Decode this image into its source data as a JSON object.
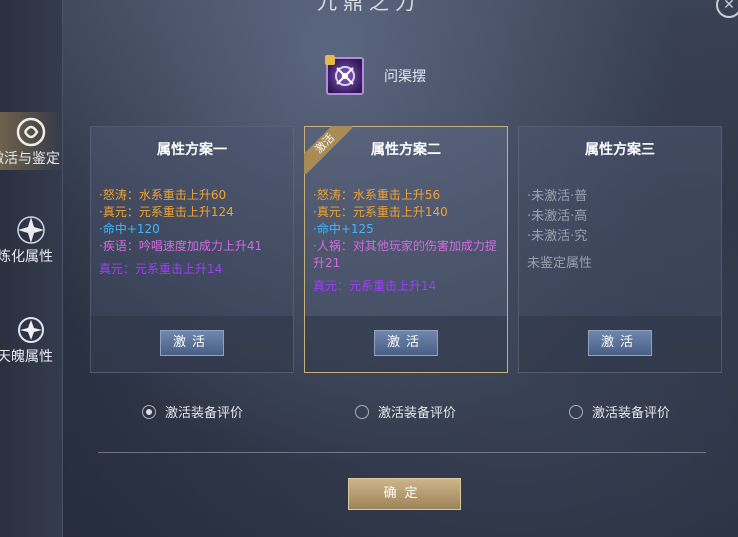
{
  "window": {
    "title": "九鼎之力",
    "close_label": "✕"
  },
  "item": {
    "name": "问渠摆"
  },
  "sidebar": {
    "tabs": [
      {
        "label": "激活与鉴定",
        "active": true
      },
      {
        "label": "炼化属性",
        "active": false
      },
      {
        "label": "天魄属性",
        "active": false
      }
    ]
  },
  "plans": [
    {
      "title": "属性方案一",
      "attrs": [
        "·怒涛：水系重击上升60",
        "·真元：元系重击上升124",
        "·命中+120",
        "·疾语：吟唱速度加成力上升41"
      ],
      "extra": "真元：元系重击上升14",
      "button": "激活",
      "radio_label": "激活装备评价",
      "radio_selected": true
    },
    {
      "title": "属性方案二",
      "badge": "激活",
      "attrs": [
        "·怒涛：水系重击上升56",
        "·真元：元系重击上升140",
        "·命中+125",
        "·人祸：对其他玩家的伤害加成力提升21"
      ],
      "extra": "真元：元系重击上升14",
      "button": "激活",
      "radio_label": "激活装备评价",
      "radio_selected": false
    },
    {
      "title": "属性方案三",
      "attrs": [
        "·未激活·普",
        "·未激活·高",
        "·未激活·究"
      ],
      "note": "未鉴定属性",
      "button": "激活",
      "radio_label": "激活装备评价",
      "radio_selected": false
    }
  ],
  "confirm_label": "确定",
  "colors": {
    "orange": "#f3a32c",
    "blue": "#3fb7ff",
    "pink": "#d16be0",
    "violet": "#a03cff",
    "gold": "#c8b07a"
  }
}
